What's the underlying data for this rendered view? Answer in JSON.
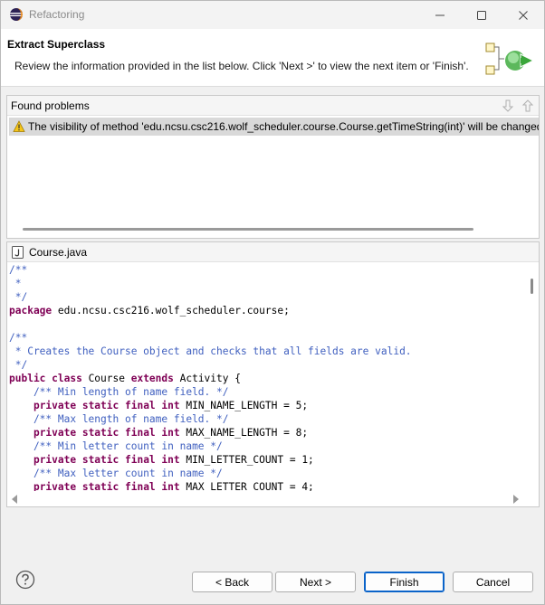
{
  "window": {
    "title": "Refactoring",
    "minimize_icon": "minimize-icon",
    "maximize_icon": "maximize-icon",
    "close_icon": "close-icon"
  },
  "banner": {
    "title": "Extract Superclass",
    "description": "Review the information provided in the list below. Click 'Next >' to view the next item or 'Finish'.",
    "graphic_icon": "wizard-refactor-icon"
  },
  "problems": {
    "label": "Found problems",
    "nav_down_icon": "arrow-down-icon",
    "nav_up_icon": "arrow-up-icon",
    "items": [
      {
        "severity_icon": "warning-icon",
        "text": "The visibility of method 'edu.ncsu.csc216.wolf_scheduler.course.Course.getTimeString(int)' will be changed"
      }
    ]
  },
  "code": {
    "filename": "Course.java",
    "file_icon": "java-file-icon",
    "lines": [
      [
        {
          "t": "/**",
          "c": "comment"
        }
      ],
      [
        {
          "t": " *",
          "c": "comment"
        }
      ],
      [
        {
          "t": " */",
          "c": "comment"
        }
      ],
      [
        {
          "t": "package",
          "c": "keyword"
        },
        {
          "t": " edu.ncsu.csc216.wolf_scheduler.course;",
          "c": "plain"
        }
      ],
      [
        {
          "t": "",
          "c": "plain"
        }
      ],
      [
        {
          "t": "/**",
          "c": "comment"
        }
      ],
      [
        {
          "t": " * Creates the Course object and checks that all fields are valid.",
          "c": "comment"
        }
      ],
      [
        {
          "t": " */",
          "c": "comment"
        }
      ],
      [
        {
          "t": "public class",
          "c": "keyword"
        },
        {
          "t": " Course ",
          "c": "plain"
        },
        {
          "t": "extends",
          "c": "keyword"
        },
        {
          "t": " Activity {",
          "c": "plain"
        }
      ],
      [
        {
          "t": "    /** Min length of name field. */",
          "c": "comment"
        }
      ],
      [
        {
          "t": "    ",
          "c": "plain"
        },
        {
          "t": "private static final int",
          "c": "keyword"
        },
        {
          "t": " MIN_NAME_LENGTH = 5;",
          "c": "plain"
        }
      ],
      [
        {
          "t": "    /** Max length of name field. */",
          "c": "comment"
        }
      ],
      [
        {
          "t": "    ",
          "c": "plain"
        },
        {
          "t": "private static final int",
          "c": "keyword"
        },
        {
          "t": " MAX_NAME_LENGTH = 8;",
          "c": "plain"
        }
      ],
      [
        {
          "t": "    /** Min letter count in name */",
          "c": "comment"
        }
      ],
      [
        {
          "t": "    ",
          "c": "plain"
        },
        {
          "t": "private static final int",
          "c": "keyword"
        },
        {
          "t": " MIN_LETTER_COUNT = 1;",
          "c": "plain"
        }
      ],
      [
        {
          "t": "    /** Max letter count in name */",
          "c": "comment"
        }
      ],
      [
        {
          "t": "    ",
          "c": "plain"
        },
        {
          "t": "private static final int",
          "c": "keyword"
        },
        {
          "t": " MAX_LETTER_COUNT = 4;",
          "c": "plain"
        }
      ]
    ]
  },
  "footer": {
    "help_icon": "help-icon",
    "back_label": "< Back",
    "next_label": "Next >",
    "finish_label": "Finish",
    "cancel_label": "Cancel"
  },
  "colors": {
    "comment": "#3f5fbf",
    "keyword": "#7f0055",
    "default_button_border": "#0a63c9",
    "selected_row": "#d9d9d9"
  }
}
